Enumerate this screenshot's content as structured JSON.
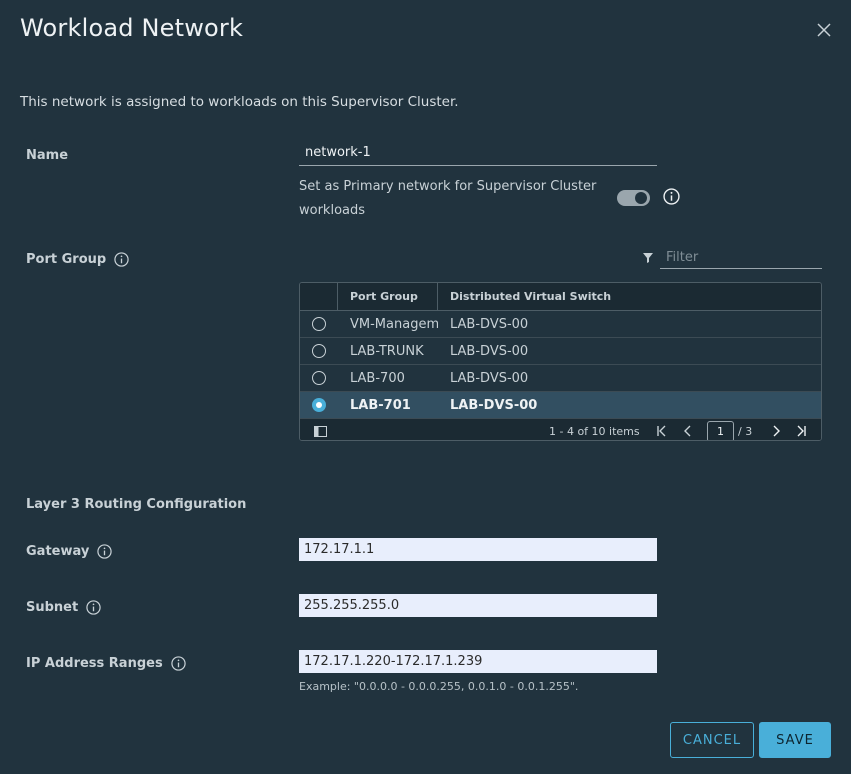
{
  "dialog": {
    "title": "Workload Network",
    "intro": "This network is assigned to workloads on this Supervisor Cluster."
  },
  "form": {
    "name_label": "Name",
    "name_value": "network-1",
    "primary_label": "Set as Primary network for Supervisor Cluster workloads",
    "primary_enabled": true,
    "port_group_label": "Port Group",
    "filter_placeholder": "Filter"
  },
  "grid": {
    "columns": [
      "Port Group",
      "Distributed Virtual Switch"
    ],
    "rows": [
      {
        "port_group": "VM-Managem",
        "dvs": "LAB-DVS-00",
        "selected": false
      },
      {
        "port_group": "LAB-TRUNK",
        "dvs": "LAB-DVS-00",
        "selected": false
      },
      {
        "port_group": "LAB-700",
        "dvs": "LAB-DVS-00",
        "selected": false
      },
      {
        "port_group": "LAB-701",
        "dvs": "LAB-DVS-00",
        "selected": true
      }
    ],
    "footer": {
      "count": "1 - 4 of 10 items",
      "page": "1",
      "total": "/ 3"
    }
  },
  "routing": {
    "section_title": "Layer 3 Routing Configuration",
    "gateway_label": "Gateway",
    "gateway_value": "172.17.1.1",
    "subnet_label": "Subnet",
    "subnet_value": "255.255.255.0",
    "ip_ranges_label": "IP Address Ranges",
    "ip_ranges_value": "172.17.1.220-172.17.1.239",
    "example": "Example: \"0.0.0.0 - 0.0.0.255, 0.0.1.0 - 0.0.1.255\"."
  },
  "buttons": {
    "cancel": "CANCEL",
    "save": "SAVE"
  },
  "colors": {
    "accent": "#49afd9",
    "background": "#21333e",
    "selected_row": "#324f61"
  }
}
